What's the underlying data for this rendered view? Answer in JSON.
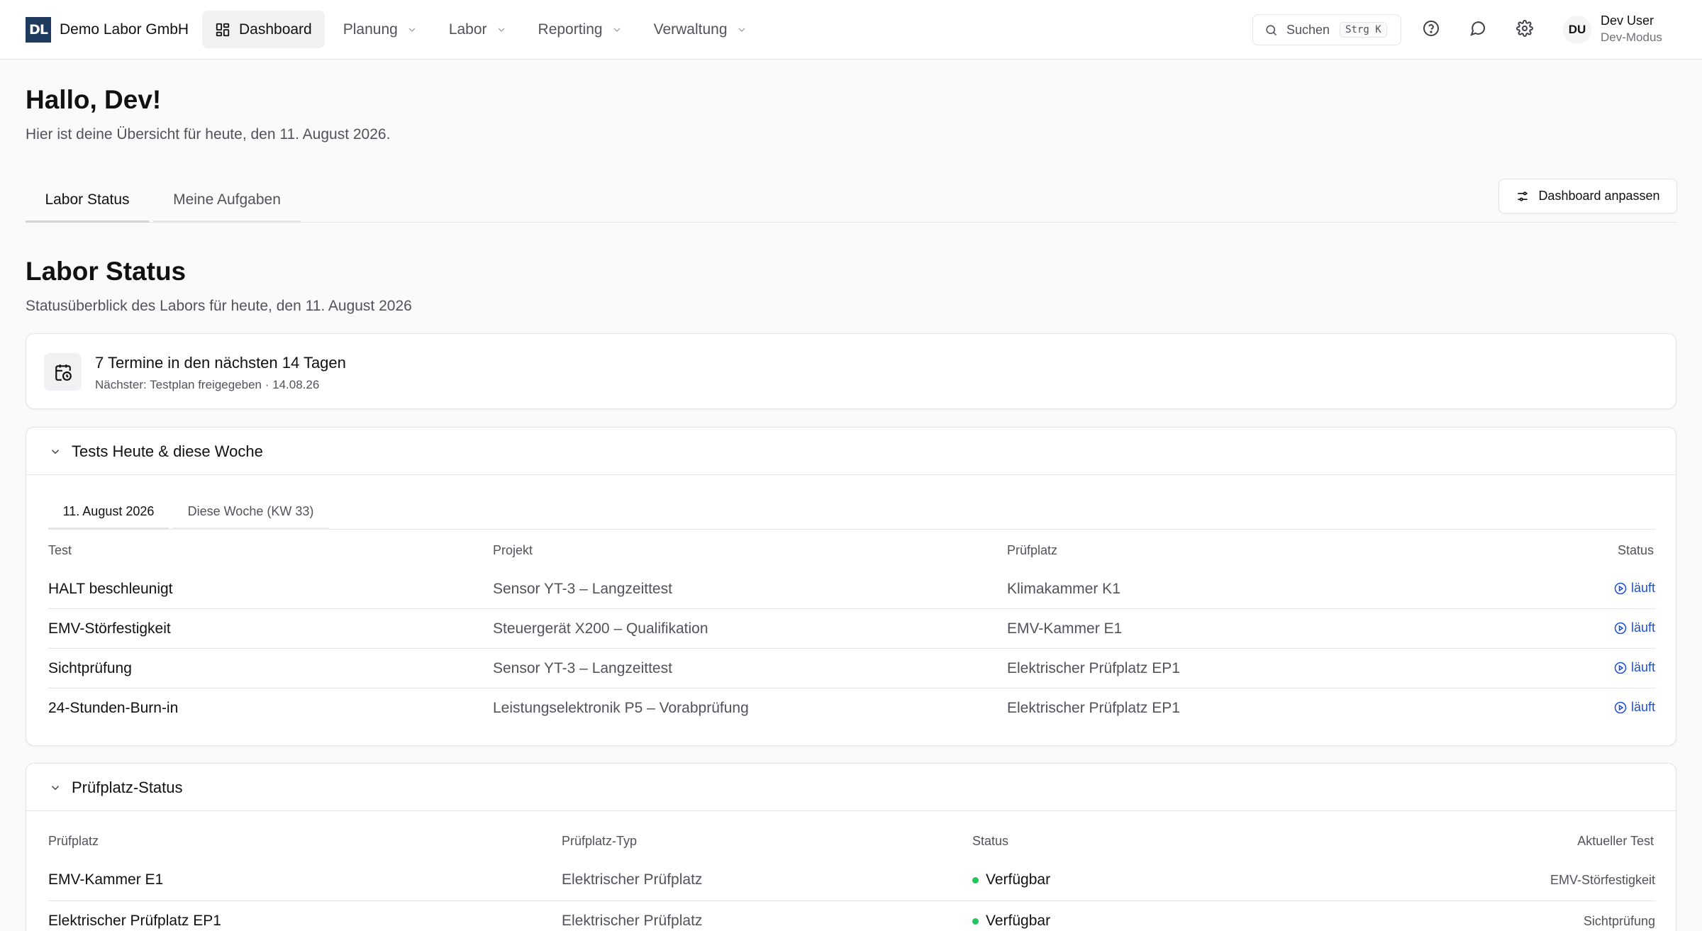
{
  "brand": {
    "logo": "DL",
    "name": "Demo Labor GmbH"
  },
  "nav": {
    "items": [
      {
        "label": "Dashboard",
        "icon": "grid-icon"
      },
      {
        "label": "Planung"
      },
      {
        "label": "Labor"
      },
      {
        "label": "Reporting"
      },
      {
        "label": "Verwaltung"
      }
    ]
  },
  "search": {
    "label": "Suchen",
    "shortcut": "Strg K"
  },
  "user": {
    "initials": "DU",
    "name": "Dev User",
    "mode": "Dev-Modus"
  },
  "greeting": {
    "title": "Hallo, Dev!",
    "subtitle": "Hier ist deine Übersicht für heute, den 11. August 2026."
  },
  "tabs": [
    {
      "label": "Labor Status"
    },
    {
      "label": "Meine Aufgaben"
    }
  ],
  "customize_label": "Dashboard anpassen",
  "section": {
    "title": "Labor Status",
    "subtitle": "Statusüberblick des Labors für heute, den 11. August 2026"
  },
  "appointments": {
    "title": "7 Termine in den nächsten 14 Tagen",
    "subtitle": "Nächster: Testplan freigegeben · 14.08.26"
  },
  "tests": {
    "title": "Tests Heute & diese Woche",
    "subtabs": [
      {
        "label": "11. August 2026"
      },
      {
        "label": "Diese Woche (KW 33)"
      }
    ],
    "columns": {
      "test": "Test",
      "project": "Projekt",
      "station": "Prüfplatz",
      "status": "Status"
    },
    "rows": [
      {
        "test": "HALT beschleunigt",
        "project": "Sensor YT-3 – Langzeittest",
        "station": "Klimakammer K1",
        "status": "läuft"
      },
      {
        "test": "EMV-Störfestigkeit",
        "project": "Steuergerät X200 – Qualifikation",
        "station": "EMV-Kammer E1",
        "status": "läuft"
      },
      {
        "test": "Sichtprüfung",
        "project": "Sensor YT-3 – Langzeittest",
        "station": "Elektrischer Prüfplatz EP1",
        "status": "läuft"
      },
      {
        "test": "24-Stunden-Burn-in",
        "project": "Leistungselektronik P5 – Vorabprüfung",
        "station": "Elektrischer Prüfplatz EP1",
        "status": "läuft"
      }
    ]
  },
  "stations": {
    "title": "Prüfplatz-Status",
    "columns": {
      "station": "Prüfplatz",
      "type": "Prüfplatz-Typ",
      "status": "Status",
      "current": "Aktueller Test"
    },
    "rows": [
      {
        "station": "EMV-Kammer E1",
        "type": "Elektrischer Prüfplatz",
        "status": "Verfügbar",
        "current": "EMV-Störfestigkeit"
      },
      {
        "station": "Elektrischer Prüfplatz EP1",
        "type": "Elektrischer Prüfplatz",
        "status": "Verfügbar",
        "current": "Sichtprüfung"
      }
    ]
  },
  "colors": {
    "accent_link": "#1d4ed8",
    "available_dot": "#22c55e",
    "brand_logo_bg": "#1e3a5f"
  }
}
